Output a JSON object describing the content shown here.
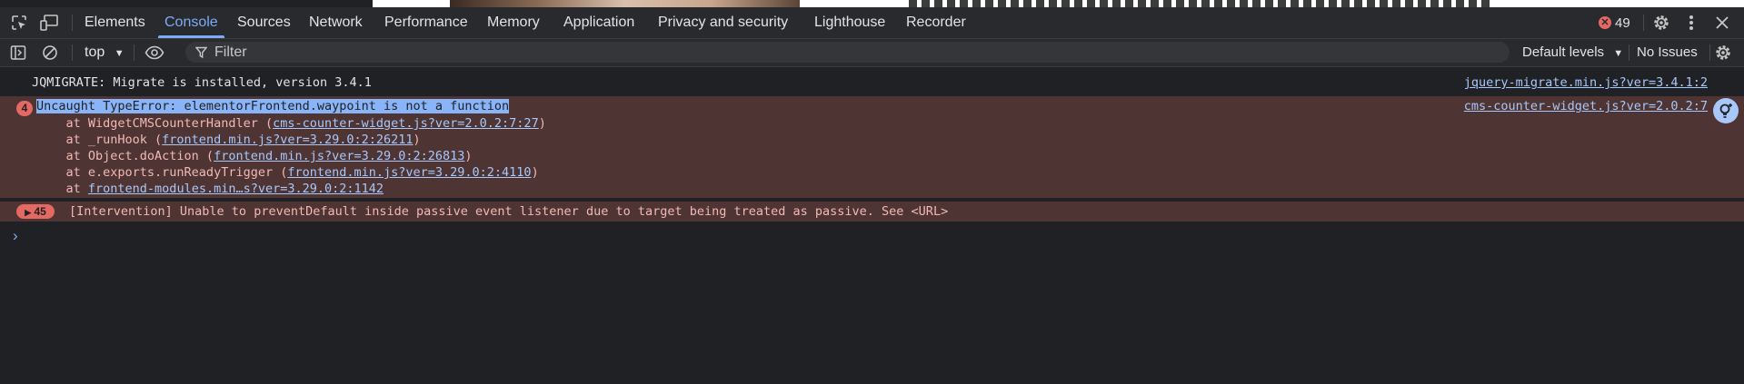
{
  "tabbar": {
    "tabs": [
      "Elements",
      "Console",
      "Sources",
      "Network",
      "Performance",
      "Memory",
      "Application",
      "Privacy and security",
      "Lighthouse",
      "Recorder"
    ],
    "active_tab": "Console",
    "error_count": "49",
    "icons": {
      "inspect": "inspect-element-icon",
      "device": "device-toolbar-icon",
      "settings": "gear-icon",
      "more": "kebab-menu-icon",
      "close": "close-icon"
    }
  },
  "filterbar": {
    "context": "top",
    "filter_placeholder": "Filter",
    "levels": "Default levels",
    "issues": "No Issues"
  },
  "messages": {
    "jqmigrate": {
      "text": "JQMIGRATE: Migrate is installed, version 3.4.1",
      "source": "jquery-migrate.min.js?ver=3.4.1:2"
    },
    "error": {
      "count": "4",
      "text": "Uncaught TypeError: elementorFrontend.waypoint is not a function",
      "source": "cms-counter-widget.js?ver=2.0.2:7",
      "stack": [
        {
          "prefix": "    at WidgetCMSCounterHandler (",
          "link": "cms-counter-widget.js?ver=2.0.2:7:27",
          "suffix": ")"
        },
        {
          "prefix": "    at _runHook (",
          "link": "frontend.min.js?ver=3.29.0:2:26211",
          "suffix": ")"
        },
        {
          "prefix": "    at Object.doAction (",
          "link": "frontend.min.js?ver=3.29.0:2:26813",
          "suffix": ")"
        },
        {
          "prefix": "    at e.exports.runReadyTrigger (",
          "link": "frontend.min.js?ver=3.29.0:2:4110",
          "suffix": ")"
        },
        {
          "prefix": "    at ",
          "link": "frontend-modules.min…s?ver=3.29.0:2:1142",
          "suffix": ""
        }
      ]
    },
    "violation": {
      "count": "45",
      "text": "[Intervention] Unable to preventDefault inside passive event listener due to target being treated as passive. See <URL>"
    }
  },
  "prompt_symbol": "›"
}
